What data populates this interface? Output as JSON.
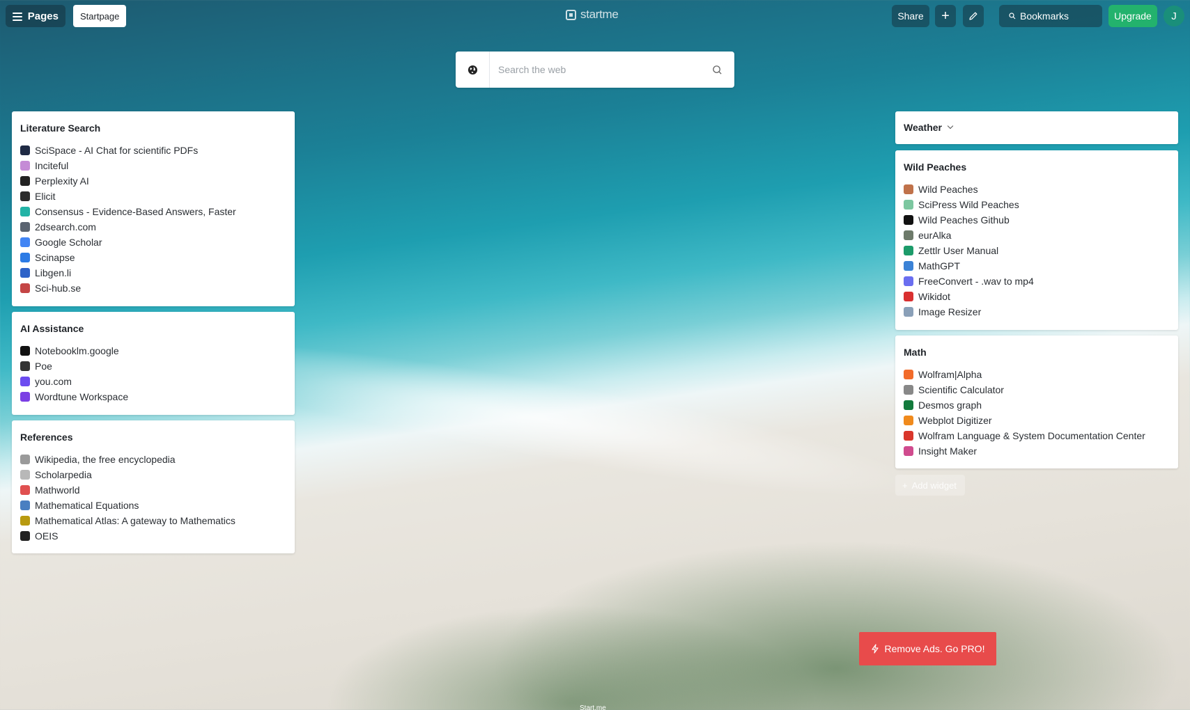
{
  "topbar": {
    "pages_label": "Pages",
    "tab_label": "Startpage",
    "logo_text": "startme",
    "share_label": "Share",
    "plus_label": "+",
    "bookmarks_label": "Bookmarks",
    "upgrade_label": "Upgrade",
    "avatar_initial": "J",
    "upgrade_color": "#23b26d"
  },
  "search": {
    "placeholder": "Search the web"
  },
  "widgets": {
    "literature": {
      "title": "Literature Search",
      "items": [
        {
          "label": "SciSpace - AI Chat for scientific PDFs",
          "icon": "scispace-icon",
          "color": "#1f2a44"
        },
        {
          "label": "Inciteful",
          "icon": "inciteful-icon",
          "color": "#c58bd6"
        },
        {
          "label": "Perplexity AI",
          "icon": "perplexity-icon",
          "color": "#222222"
        },
        {
          "label": "Elicit",
          "icon": "elicit-icon",
          "color": "#2b2b2b"
        },
        {
          "label": "Consensus - Evidence-Based Answers, Faster",
          "icon": "consensus-icon",
          "color": "#22b3a6"
        },
        {
          "label": "2dsearch.com",
          "icon": "2dsearch-icon",
          "color": "#5a6370"
        },
        {
          "label": "Google Scholar",
          "icon": "google-scholar-icon",
          "color": "#4285f4"
        },
        {
          "label": "Scinapse",
          "icon": "scinapse-icon",
          "color": "#2c7be5"
        },
        {
          "label": "Libgen.li",
          "icon": "libgen-icon",
          "color": "#2d62c8"
        },
        {
          "label": "Sci-hub.se",
          "icon": "scihub-icon",
          "color": "#c44545"
        }
      ]
    },
    "ai": {
      "title": "AI Assistance",
      "items": [
        {
          "label": "Notebooklm.google",
          "icon": "notebooklm-icon",
          "color": "#111111"
        },
        {
          "label": "Poe",
          "icon": "poe-icon",
          "color": "#333333"
        },
        {
          "label": "you.com",
          "icon": "you-icon",
          "color": "#6c4cf0"
        },
        {
          "label": "Wordtune Workspace",
          "icon": "wordtune-icon",
          "color": "#7b3fe4"
        }
      ]
    },
    "references": {
      "title": "References",
      "items": [
        {
          "label": "Wikipedia, the free encyclopedia",
          "icon": "wikipedia-icon",
          "color": "#9a9a9a"
        },
        {
          "label": "Scholarpedia",
          "icon": "scholarpedia-icon",
          "color": "#b8b8b8"
        },
        {
          "label": "Mathworld",
          "icon": "mathworld-icon",
          "color": "#e05050"
        },
        {
          "label": "Mathematical Equations",
          "icon": "equations-icon",
          "color": "#4a7fc1"
        },
        {
          "label": "Mathematical Atlas: A gateway to Mathematics",
          "icon": "math-atlas-icon",
          "color": "#b89a10"
        },
        {
          "label": "OEIS",
          "icon": "oeis-icon",
          "color": "#222222"
        }
      ]
    },
    "weather": {
      "title": "Weather"
    },
    "wild": {
      "title": "Wild Peaches",
      "items": [
        {
          "label": "Wild Peaches",
          "icon": "wild-peaches-icon",
          "color": "#c0724a"
        },
        {
          "label": "SciPress Wild Peaches",
          "icon": "scipress-icon",
          "color": "#7cc7a0"
        },
        {
          "label": "Wild Peaches Github",
          "icon": "github-icon",
          "color": "#111111"
        },
        {
          "label": "eurAlka",
          "icon": "euralka-icon",
          "color": "#6d7a6a"
        },
        {
          "label": "Zettlr User Manual",
          "icon": "zettlr-icon",
          "color": "#1c9b6a"
        },
        {
          "label": "MathGPT",
          "icon": "mathgpt-icon",
          "color": "#3b82d6"
        },
        {
          "label": "FreeConvert - .wav to mp4",
          "icon": "freeconvert-icon",
          "color": "#6a6ef0"
        },
        {
          "label": "Wikidot",
          "icon": "wikidot-icon",
          "color": "#d93030"
        },
        {
          "label": "Image Resizer",
          "icon": "image-resizer-icon",
          "color": "#8aa0b8"
        }
      ]
    },
    "math": {
      "title": "Math",
      "items": [
        {
          "label": "Wolfram|Alpha",
          "icon": "wolframalpha-icon",
          "color": "#f26b2a"
        },
        {
          "label": "Scientific Calculator",
          "icon": "calculator-icon",
          "color": "#888888"
        },
        {
          "label": "Desmos graph",
          "icon": "desmos-icon",
          "color": "#127a3c"
        },
        {
          "label": "Webplot Digitizer",
          "icon": "webplot-icon",
          "color": "#f08a1c"
        },
        {
          "label": "Wolfram Language & System Documentation Center",
          "icon": "wolfram-language-icon",
          "color": "#d9362b"
        },
        {
          "label": "Insight Maker",
          "icon": "insight-maker-icon",
          "color": "#d04b8e"
        }
      ]
    }
  },
  "add_widget_label": "Add widget",
  "remove_ads_label": "Remove Ads. Go PRO!",
  "remove_ads_color": "#e84b4b",
  "footer_text": "Start.me"
}
